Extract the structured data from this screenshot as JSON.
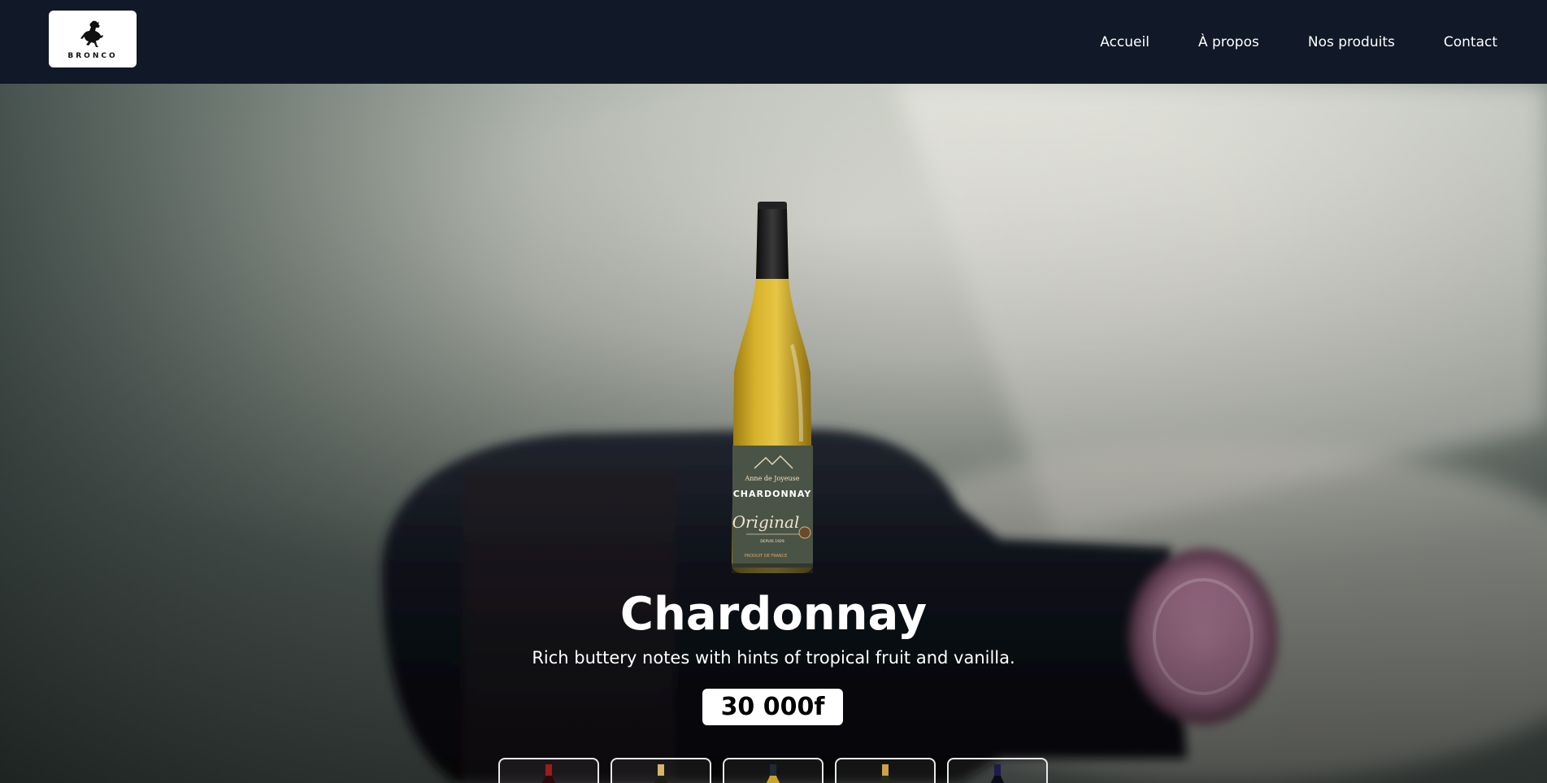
{
  "brand": {
    "logo_text": "BRONCO",
    "logo_icon": "bucking-horse-icon"
  },
  "nav": {
    "items": [
      {
        "label": "Accueil"
      },
      {
        "label": "À propos"
      },
      {
        "label": "Nos produits"
      },
      {
        "label": "Contact"
      }
    ]
  },
  "hero": {
    "product": {
      "name": "Chardonnay",
      "description": "Rich buttery notes with hints of tropical fruit and vanilla.",
      "price": "30 000f",
      "label": {
        "maker": "Anne de Joyeuse",
        "name": "CHARDONNAY",
        "script": "Original",
        "since": "DEPUIS 1929",
        "origin": "PRODUIT DE FRANCE"
      }
    },
    "thumbnails": [
      {
        "name": "red-wine-thumbnail",
        "capsule": "#b91c1c"
      },
      {
        "name": "champagne-thumbnail",
        "capsule": "#d6b46a"
      },
      {
        "name": "white-wine-thumbnail",
        "capsule": "#1f2937"
      },
      {
        "name": "sparkling-thumbnail",
        "capsule": "#c9a24a"
      },
      {
        "name": "dark-bottle-thumbnail",
        "capsule": "#1e1b4b"
      }
    ]
  },
  "colors": {
    "navbar": "#111827",
    "text": "#ffffff",
    "price_bg": "#ffffff"
  }
}
